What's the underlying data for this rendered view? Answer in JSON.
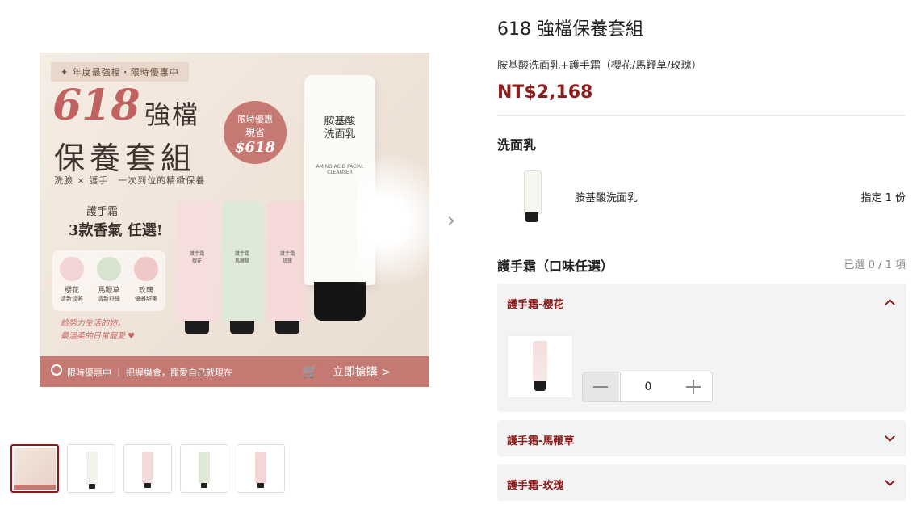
{
  "hero": {
    "top_tag": "✦ 年度最強檔・限時優惠中",
    "big_number": "618",
    "headline_a": "強檔",
    "headline_b": "保養套組",
    "tagline": "洗臉 × 護手　一次到位的精緻保養",
    "badge_line1": "限時優惠",
    "badge_line2": "現省",
    "badge_amount": "$618",
    "handcream_caption": "護手霜",
    "scent_choice": "3款香氣 任選!",
    "scents": [
      {
        "name": "櫻花",
        "sub": "清新淡雅"
      },
      {
        "name": "馬鞭草",
        "sub": "清新舒緩"
      },
      {
        "name": "玫瑰",
        "sub": "優雅甜美"
      }
    ],
    "tube_labels": [
      "護手霜\n櫻花",
      "護手霜\n馬鞭草",
      "護手霜\n玫瑰"
    ],
    "cleanser_label": "胺基酸\n洗面乳",
    "cleanser_sub": "AMINO ACID FACIAL CLEANSER",
    "quote_line1": "給努力生活的妳，",
    "quote_line2": "最溫柔的日常寵愛 ♥",
    "bottom_left": "限時優惠中 ｜ 把握機會，寵愛自己就現在",
    "bottom_cta": "立即搶購 >",
    "cart_icon": "cart-icon",
    "colors": {
      "accent": "#c47a72",
      "pink": "#f4d9d9",
      "green": "#dde9d6"
    }
  },
  "gallery": {
    "next_arrow": "›",
    "thumbs": [
      {
        "kind": "banner"
      },
      {
        "kind": "cleanser",
        "color": "#f4f2ec"
      },
      {
        "kind": "sakura",
        "color": "#f3dada"
      },
      {
        "kind": "verbena",
        "color": "#dfe8d6"
      },
      {
        "kind": "rose",
        "color": "#f4d6d6"
      }
    ]
  },
  "product": {
    "title": "618 強檔保養套組",
    "subtitle": "胺基酸洗面乳+護手霜（櫻花/馬鞭草/玫瑰）",
    "price": "NT$2,168",
    "price_color": "#8b1d1d"
  },
  "section_cleanser": {
    "title": "洗面乳",
    "item_name": "胺基酸洗面乳",
    "item_qty": "指定 1 份"
  },
  "section_handcream": {
    "title": "護手霜（口味任選）",
    "count": "已選 0 / 1 項",
    "options": [
      {
        "label": "護手霜-櫻花",
        "expanded": true,
        "quantity": "0"
      },
      {
        "label": "護手霜-馬鞭草",
        "expanded": false
      },
      {
        "label": "護手霜-玫瑰",
        "expanded": false
      }
    ]
  }
}
